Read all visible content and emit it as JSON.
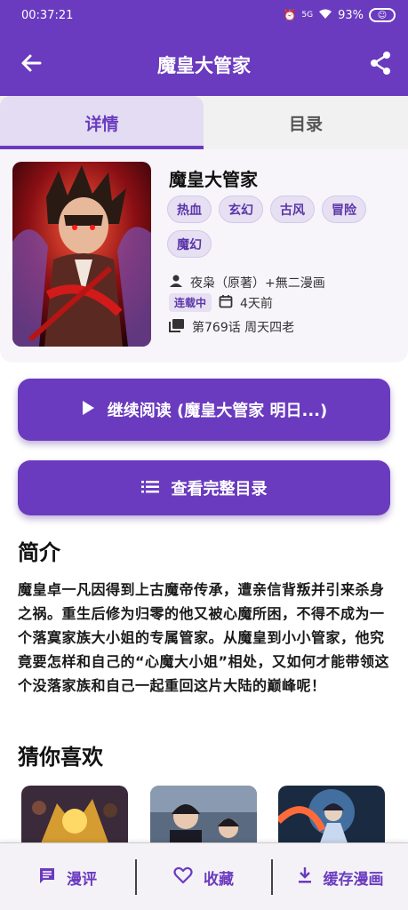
{
  "status_bar": {
    "time": "00:37:21",
    "battery": "93%",
    "network": "5G"
  },
  "app_bar": {
    "title": "魔皇大管家"
  },
  "tabs": [
    {
      "label": "详情"
    },
    {
      "label": "目录"
    }
  ],
  "book": {
    "title": "魔皇大管家",
    "tags": [
      "热血",
      "玄幻",
      "古风",
      "冒险",
      "魔幻"
    ],
    "author": "夜枭（原著）+無二漫画",
    "status_badge": "连载中",
    "updated": "4天前",
    "latest_chapter": "第769话 周天四老"
  },
  "buttons": {
    "continue_reading": "继续阅读 (魔皇大管家 明日...)",
    "full_catalog": "查看完整目录"
  },
  "intro": {
    "heading": "简介",
    "text": "魔皇卓一凡因得到上古魔帝传承，遭亲信背叛并引来杀身之祸。重生后修为归零的他又被心魔所困，不得不成为一个落寞家族大小姐的专属管家。从魔皇到小小管家，他究竟要怎样和自己的“心魔大小姐”相处，又如何才能带领这个没落家族和自己一起重回这片大陆的巅峰呢！"
  },
  "recommend": {
    "heading": "猜你喜欢"
  },
  "bottom_bar": {
    "comment": "漫评",
    "favorite": "收藏",
    "cache": "缓存漫画"
  },
  "colors": {
    "primary": "#6a3bbf",
    "tag_bg": "#e6e0f2"
  }
}
